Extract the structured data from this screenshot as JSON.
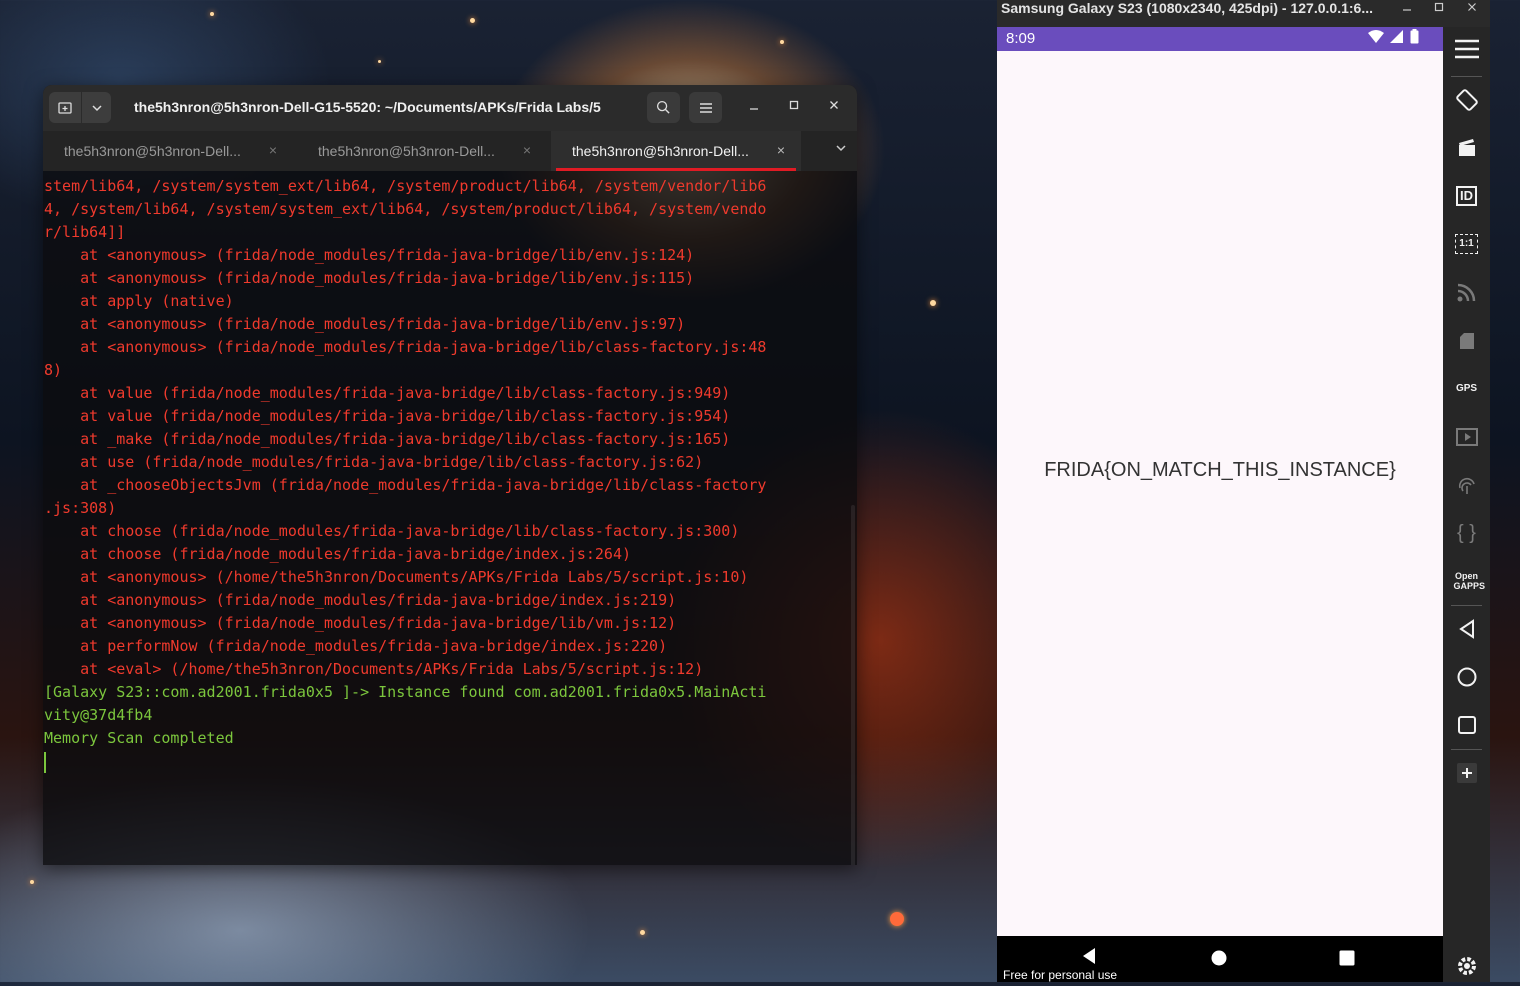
{
  "terminal": {
    "title": "the5h3nron@5h3nron-Dell-G15-5520: ~/Documents/APKs/Frida Labs/5",
    "tabs": [
      {
        "label": "the5h3nron@5h3nron-Dell...",
        "close": "×"
      },
      {
        "label": "the5h3nron@5h3nron-Dell...",
        "close": "×"
      },
      {
        "label": "the5h3nron@5h3nron-Dell...",
        "close": "×"
      }
    ],
    "lines": [
      "stem/lib64, /system/system_ext/lib64, /system/product/lib64, /system/vendor/lib6",
      "4, /system/lib64, /system/system_ext/lib64, /system/product/lib64, /system/vendo",
      "r/lib64]]",
      "    at <anonymous> (frida/node_modules/frida-java-bridge/lib/env.js:124)",
      "    at <anonymous> (frida/node_modules/frida-java-bridge/lib/env.js:115)",
      "    at apply (native)",
      "    at <anonymous> (frida/node_modules/frida-java-bridge/lib/env.js:97)",
      "    at <anonymous> (frida/node_modules/frida-java-bridge/lib/class-factory.js:48",
      "8)",
      "    at value (frida/node_modules/frida-java-bridge/lib/class-factory.js:949)",
      "    at value (frida/node_modules/frida-java-bridge/lib/class-factory.js:954)",
      "    at _make (frida/node_modules/frida-java-bridge/lib/class-factory.js:165)",
      "    at use (frida/node_modules/frida-java-bridge/lib/class-factory.js:62)",
      "    at _chooseObjectsJvm (frida/node_modules/frida-java-bridge/lib/class-factory",
      ".js:308)",
      "    at choose (frida/node_modules/frida-java-bridge/lib/class-factory.js:300)",
      "    at choose (frida/node_modules/frida-java-bridge/index.js:264)",
      "    at <anonymous> (/home/the5h3nron/Documents/APKs/Frida Labs/5/script.js:10)",
      "    at <anonymous> (frida/node_modules/frida-java-bridge/index.js:219)",
      "    at <anonymous> (frida/node_modules/frida-java-bridge/lib/vm.js:12)",
      "    at performNow (frida/node_modules/frida-java-bridge/index.js:220)",
      "    at <eval> (/home/the5h3nron/Documents/APKs/Frida Labs/5/script.js:12)"
    ],
    "green_lines": [
      "[Galaxy S23::com.ad2001.frida0x5 ]-> Instance found com.ad2001.frida0x5.MainActi",
      "vity@37d4fb4",
      "Memory Scan completed"
    ],
    "colors": {
      "error": "#ef3a2d",
      "prompt": "#7cc63d",
      "tab_underline": "#e01b24"
    }
  },
  "emulator": {
    "window_title": "Samsung Galaxy S23 (1080x2340, 425dpi) - 127.0.0.1:6...",
    "status_time": "8:09",
    "flag_text": "FRIDA{ON_MATCH_THIS_INSTANCE}",
    "watermark": "Free for personal use",
    "status_bar_color": "#6a4dbd",
    "sidebar_icons": [
      "menu-icon",
      "rotate-icon",
      "screenshot-icon",
      "device-id-icon",
      "resize-1-1-icon",
      "cast-icon",
      "sd-card-icon",
      "gps-icon",
      "screen-record-icon",
      "fingerprint-icon",
      "api-icon",
      "open-gapps-icon",
      "back-icon",
      "home-icon",
      "overview-icon",
      "add-icon",
      "settings-icon"
    ],
    "labels": {
      "id": "ID",
      "ratio": "1:1",
      "gps": "GPS",
      "gapps": "Open GAPPS",
      "api": "{ }"
    }
  }
}
